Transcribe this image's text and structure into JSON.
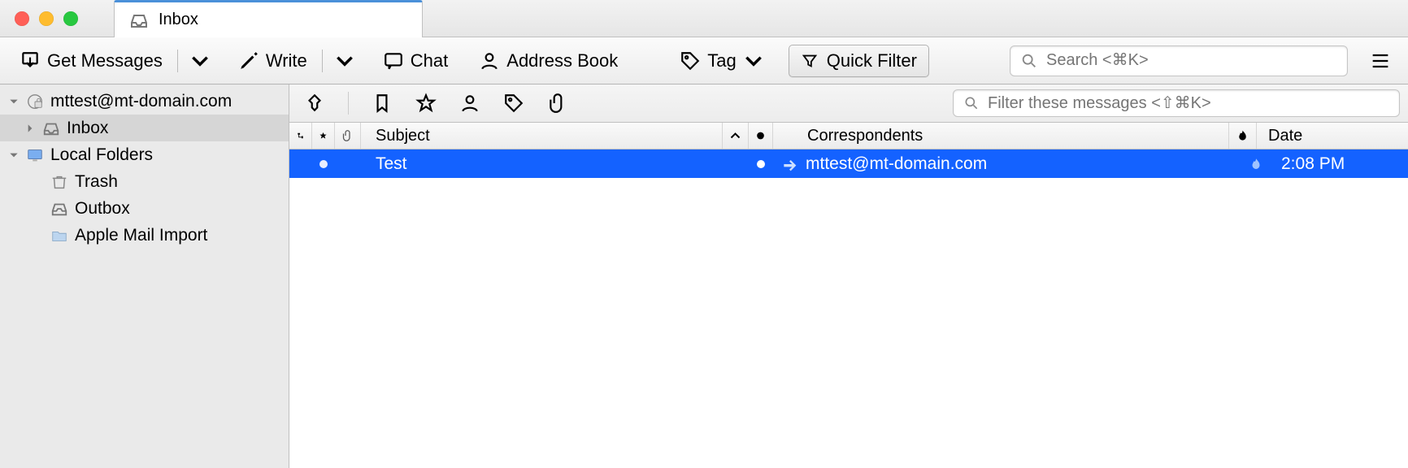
{
  "tab": {
    "title": "Inbox"
  },
  "toolbar": {
    "get_messages": "Get Messages",
    "write": "Write",
    "chat": "Chat",
    "address_book": "Address Book",
    "tag": "Tag",
    "quick_filter": "Quick Filter",
    "search_placeholder": "Search <⌘K>"
  },
  "sidebar": {
    "account": "mttest@mt-domain.com",
    "inbox": "Inbox",
    "local_folders": "Local Folders",
    "trash": "Trash",
    "outbox": "Outbox",
    "apple_mail_import": "Apple Mail Import"
  },
  "filterbar": {
    "placeholder": "Filter these messages <⇧⌘K>"
  },
  "columns": {
    "subject": "Subject",
    "correspondents": "Correspondents",
    "date": "Date"
  },
  "messages": [
    {
      "subject": "Test",
      "correspondent": "mttest@mt-domain.com",
      "date": "2:08 PM",
      "unread": true,
      "replied": true
    }
  ]
}
